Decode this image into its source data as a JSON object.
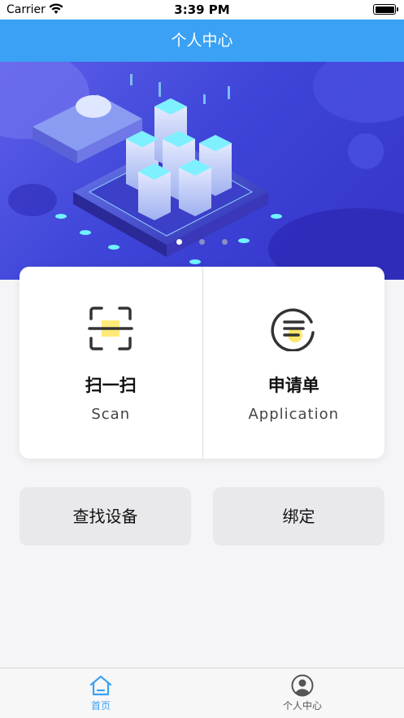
{
  "status_bar": {
    "carrier": "Carrier",
    "time": "3:39 PM"
  },
  "nav": {
    "title": "个人中心"
  },
  "banner": {
    "slides": 3,
    "active_slide": 1
  },
  "cards": [
    {
      "title": "扫一扫",
      "subtitle": "Scan",
      "icon": "scan-icon"
    },
    {
      "title": "申请单",
      "subtitle": "Application",
      "icon": "list-icon"
    }
  ],
  "buttons": {
    "find_device": "查找设备",
    "bind": "绑定"
  },
  "tabs": [
    {
      "label": "首页",
      "icon": "home-icon",
      "active": true
    },
    {
      "label": "个人中心",
      "icon": "profile-icon",
      "active": false
    }
  ],
  "colors": {
    "primary": "#3aa1f5",
    "tab_inactive": "#666666",
    "accent_yellow": "#ffe86b"
  }
}
